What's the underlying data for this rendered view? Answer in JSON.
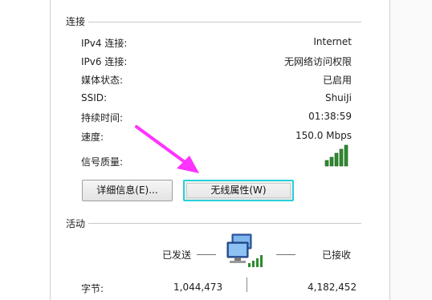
{
  "connection": {
    "title": "连接",
    "rows": [
      {
        "label": "IPv4 连接:",
        "value": "Internet"
      },
      {
        "label": "IPv6 连接:",
        "value": "无网络访问权限"
      },
      {
        "label": "媒体状态:",
        "value": "已启用"
      },
      {
        "label": "SSID:",
        "value": "ShuiJi"
      },
      {
        "label": "持续时间:",
        "value": "01:38:59"
      },
      {
        "label": "速度:",
        "value": "150.0 Mbps"
      }
    ],
    "signal_label": "信号质量:",
    "signal_level": 1.0
  },
  "buttons": {
    "details": "详细信息(E)...",
    "wireless_properties": "无线属性(W)"
  },
  "activity": {
    "title": "活动",
    "sent_label": "已发送",
    "received_label": "已接收",
    "bytes_label": "字节:",
    "bytes_sent": "1,044,473",
    "bytes_received": "4,182,452"
  },
  "colors": {
    "arrow": "#ff33ff",
    "focus_border": "#27d0d9",
    "signal_green": "#2e8b2e"
  },
  "icons": {
    "signal": "signal-bars-icon",
    "network": "network-computer-icon",
    "annotation": "pointer-arrow-icon"
  }
}
